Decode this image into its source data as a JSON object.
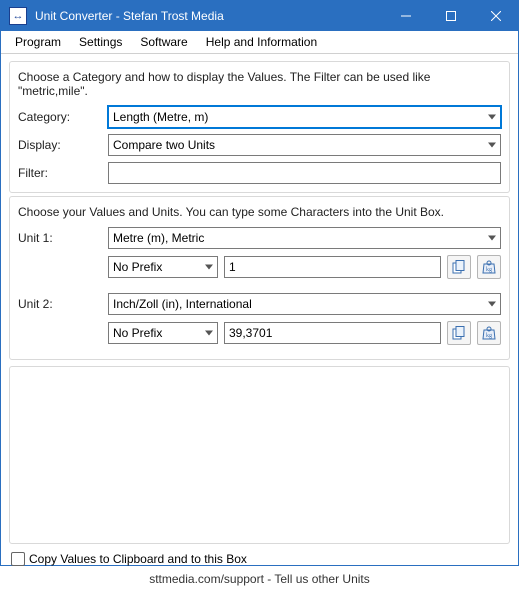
{
  "window": {
    "title": "Unit Converter - Stefan Trost Media",
    "app_icon_glyph": "↔"
  },
  "menu": {
    "program": "Program",
    "settings": "Settings",
    "software": "Software",
    "help": "Help and Information"
  },
  "section1": {
    "hint": "Choose a Category and how to display the Values. The Filter can be used like \"metric,mile\".",
    "category_label": "Category:",
    "category_value": "Length (Metre, m)",
    "display_label": "Display:",
    "display_value": "Compare two Units",
    "filter_label": "Filter:",
    "filter_value": ""
  },
  "section2": {
    "hint": "Choose your Values and Units. You can type some Characters into the Unit Box.",
    "unit1": {
      "label": "Unit 1:",
      "unit_value": "Metre (m), Metric",
      "prefix": "No Prefix",
      "value": "1"
    },
    "unit2": {
      "label": "Unit 2:",
      "unit_value": "Inch/Zoll (in), International",
      "prefix": "No Prefix",
      "value": "39,3701"
    }
  },
  "copy_checkbox_label": "Copy Values to Clipboard and to this Box",
  "footer": "sttmedia.com/support - Tell us other Units",
  "icons": {
    "copy": "copy-icon",
    "kg": "weight-kg-icon"
  }
}
